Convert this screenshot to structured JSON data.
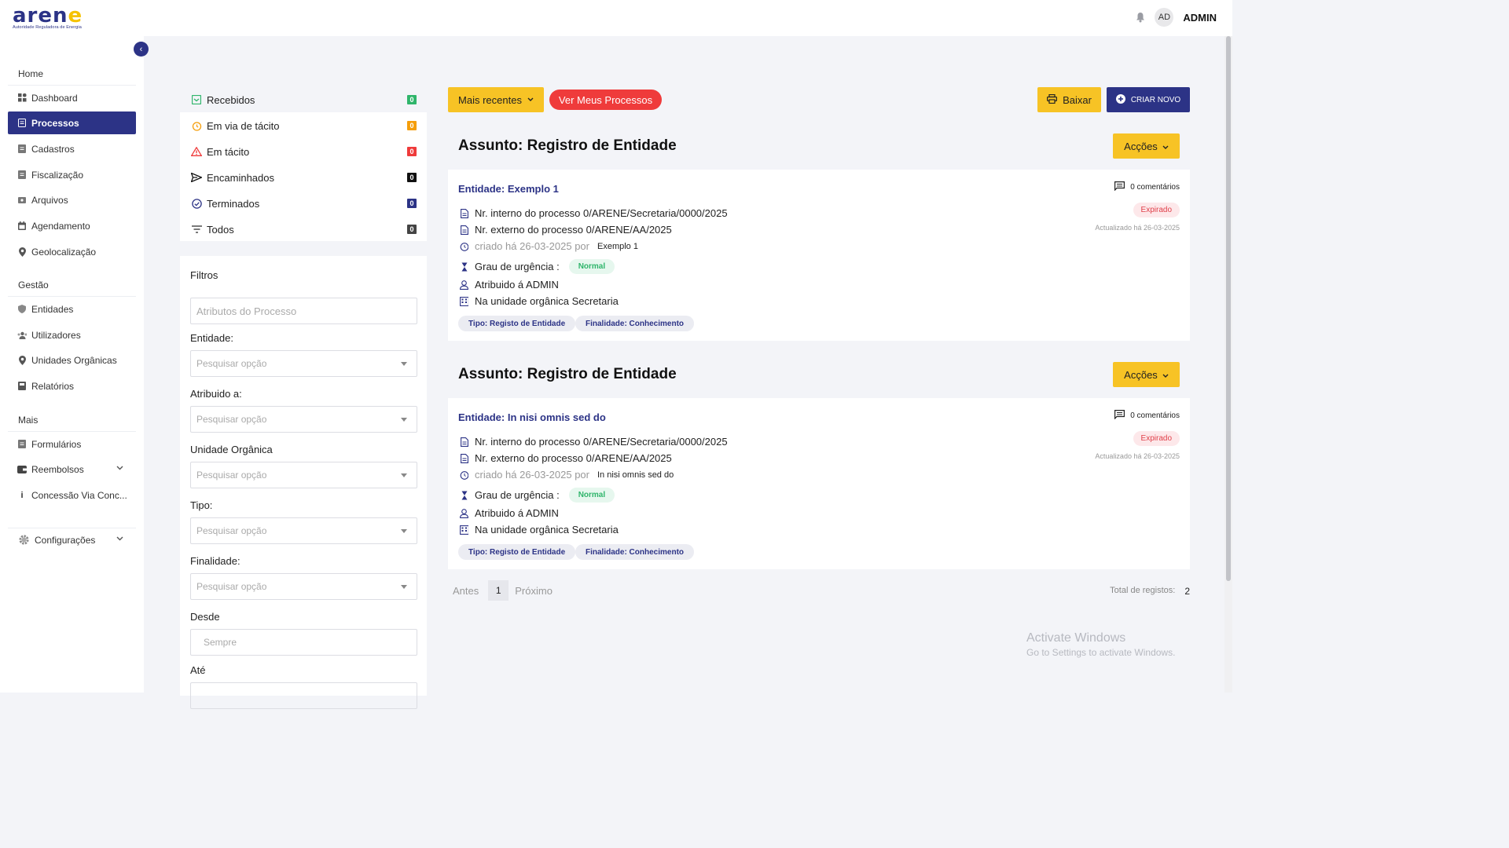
{
  "header": {
    "logo_text": "aren",
    "logo_accent": "e",
    "logo_subtitle": "Autoridade Reguladora de Energia",
    "avatar_initials": "AD",
    "user_name": "ADMIN"
  },
  "sidebar": {
    "sections": {
      "home": "Home",
      "gestao": "Gestão",
      "mais": "Mais"
    },
    "items": [
      {
        "label": "Dashboard"
      },
      {
        "label": "Processos"
      },
      {
        "label": "Cadastros"
      },
      {
        "label": "Fiscalização"
      },
      {
        "label": "Arquivos"
      },
      {
        "label": "Agendamento"
      },
      {
        "label": "Geolocalização"
      },
      {
        "label": "Entidades"
      },
      {
        "label": "Utilizadores"
      },
      {
        "label": "Unidades Orgânicas"
      },
      {
        "label": "Relatórios"
      },
      {
        "label": "Formulários"
      },
      {
        "label": "Reembolsos"
      },
      {
        "label": "Concessão Via Conc..."
      },
      {
        "label": "Configurações"
      }
    ]
  },
  "status_list": [
    {
      "label": "Recebidos",
      "count": "0",
      "color": "#2fb56b"
    },
    {
      "label": "Em via de tácito",
      "count": "0",
      "color": "#f59e0b"
    },
    {
      "label": "Em tácito",
      "count": "0",
      "color": "#ef3b3b"
    },
    {
      "label": "Encaminhados",
      "count": "0",
      "color": "#111111"
    },
    {
      "label": "Terminados",
      "count": "0",
      "color": "#2c3386"
    },
    {
      "label": "Todos",
      "count": "0",
      "color": "#444444"
    }
  ],
  "filters": {
    "title": "Filtros",
    "attributes_placeholder": "Atributos do Processo",
    "entidade_label": "Entidade:",
    "atribuido_label": "Atribuido a:",
    "unidade_label": "Unidade Orgânica",
    "tipo_label": "Tipo:",
    "finalidade_label": "Finalidade:",
    "desde_label": "Desde",
    "ate_label": "Até",
    "select_placeholder": "Pesquisar opção",
    "desde_value": "Sempre"
  },
  "toolbar": {
    "sort_label": "Mais recentes",
    "my_processes_label": "Ver Meus Processos",
    "download_label": "Baixar",
    "create_label": "CRIAR NOVO"
  },
  "processes": [
    {
      "subject": "Assunto: Registro de Entidade",
      "actions_label": "Acções",
      "entity": "Entidade: Exemplo 1",
      "comments": "0 comentários",
      "status": "Expirado",
      "updated": "Actualizado há 26-03-2025",
      "internal_nr": "Nr. interno do processo 0/ARENE/Secretaria/0000/2025",
      "external_nr": "Nr. externo do processo 0/ARENE/AA/2025",
      "created": "criado há 26-03-2025 por",
      "created_by": "Exemplo 1",
      "urgency_label": "Grau de urgência :",
      "urgency": "Normal",
      "assigned": "Atribuido á ADMIN",
      "unit": "Na unidade orgânica Secretaria",
      "tag_type": "Tipo: Registo de Entidade",
      "tag_purpose": "Finalidade: Conhecimento"
    },
    {
      "subject": "Assunto: Registro de Entidade",
      "actions_label": "Acções",
      "entity": "Entidade: In nisi omnis sed do",
      "comments": "0 comentários",
      "status": "Expirado",
      "updated": "Actualizado há 26-03-2025",
      "internal_nr": "Nr. interno do processo 0/ARENE/Secretaria/0000/2025",
      "external_nr": "Nr. externo do processo 0/ARENE/AA/2025",
      "created": "criado há 26-03-2025 por",
      "created_by": "In nisi omnis sed do",
      "urgency_label": "Grau de urgência :",
      "urgency": "Normal",
      "assigned": "Atribuido á ADMIN",
      "unit": "Na unidade orgânica Secretaria",
      "tag_type": "Tipo: Registo de Entidade",
      "tag_purpose": "Finalidade: Conhecimento"
    }
  ],
  "pagination": {
    "prev_label": "Antes",
    "page": "1",
    "next_label": "Próximo",
    "total_label": "Total de registos:",
    "total_value": "2"
  },
  "watermark": {
    "line1": "Activate Windows",
    "line2": "Go to Settings to activate Windows."
  }
}
